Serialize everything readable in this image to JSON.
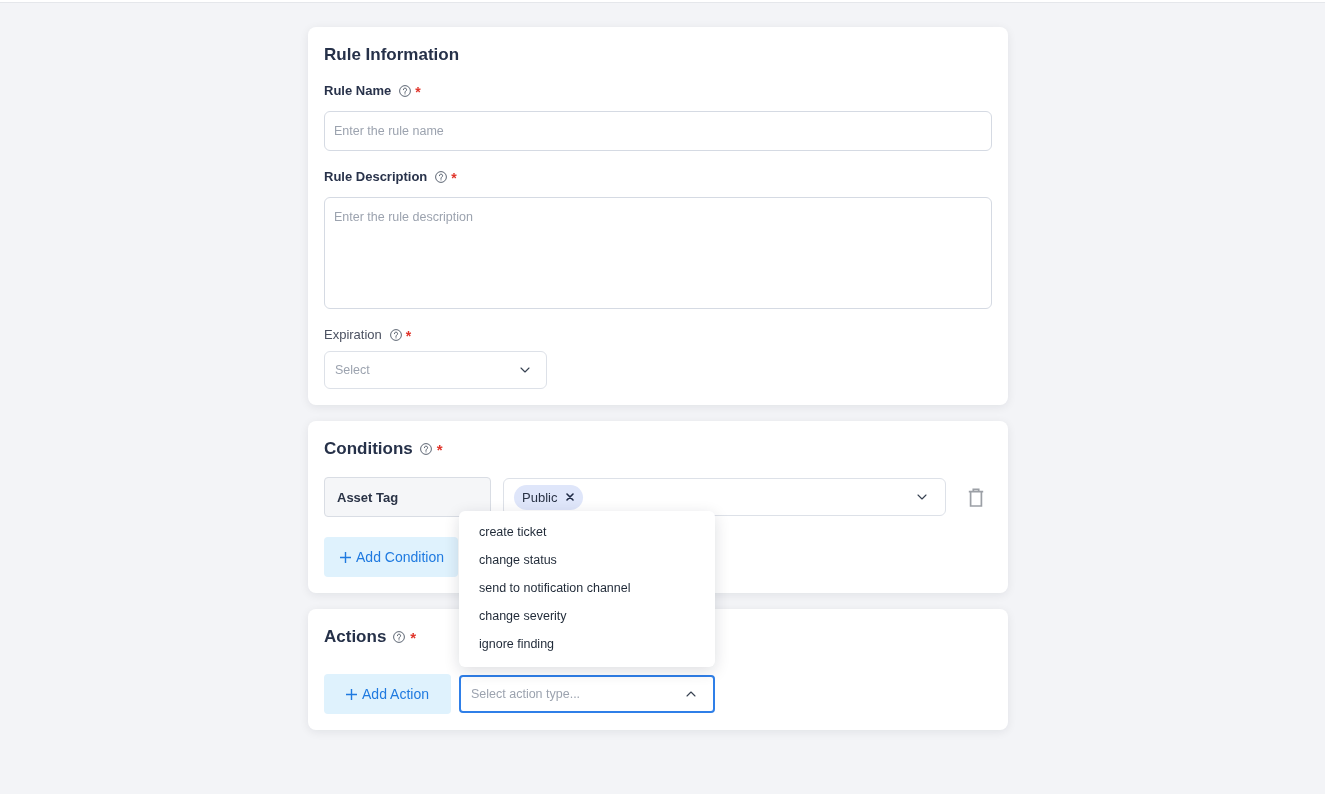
{
  "rule_information": {
    "title": "Rule Information",
    "fields": [
      {
        "kind": "text",
        "label": "Rule Name",
        "required_mark": "*",
        "placeholder": "Enter the rule name"
      },
      {
        "kind": "textarea",
        "label": "Rule Description",
        "required_mark": "*",
        "placeholder": "Enter the rule description"
      },
      {
        "kind": "select",
        "label": "Expiration",
        "required_mark": "*",
        "placeholder": "Select",
        "expanded": false
      }
    ]
  },
  "conditions": {
    "title": "Conditions",
    "required_mark": "*",
    "rows": [
      {
        "field": "Asset Tag",
        "values": [
          "Public"
        ],
        "expanded": false
      }
    ],
    "add_button": "Add Condition"
  },
  "actions": {
    "title": "Actions",
    "required_mark": "*",
    "add_button": "Add Action",
    "action_type": {
      "placeholder": "Select action type...",
      "expanded": true,
      "options": [
        {
          "label": "create ticket",
          "selected": false
        },
        {
          "label": "change status",
          "selected": false
        },
        {
          "label": "send to notification channel",
          "selected": false
        },
        {
          "label": "change severity",
          "selected": false
        },
        {
          "label": "ignore finding",
          "selected": false
        }
      ]
    }
  }
}
